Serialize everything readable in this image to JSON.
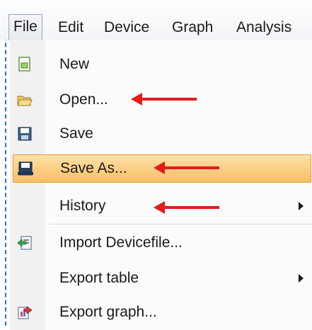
{
  "menubar": {
    "items": [
      "File",
      "Edit",
      "Device",
      "Graph",
      "Analysis"
    ]
  },
  "file_menu": {
    "items": [
      {
        "label": "New",
        "icon": "new-file-icon",
        "submenu": false
      },
      {
        "label": "Open...",
        "icon": "folder-open-icon",
        "submenu": false
      },
      {
        "label": "Save",
        "icon": "floppy-disk-icon",
        "submenu": false
      },
      {
        "label": "Save As...",
        "icon": "floppy-disk-save-as-icon",
        "submenu": false,
        "highlighted": true
      },
      {
        "label": "History",
        "icon": "",
        "submenu": true
      },
      {
        "label": "Import Devicefile...",
        "icon": "import-device-icon",
        "submenu": false
      },
      {
        "label": "Export table",
        "icon": "",
        "submenu": true
      },
      {
        "label": "Export graph...",
        "icon": "export-graph-icon",
        "submenu": false
      }
    ]
  },
  "colors": {
    "highlight": "#f9be64",
    "annotation_arrow": "#e31b1b",
    "dashed_border": "#2f6fd6"
  }
}
